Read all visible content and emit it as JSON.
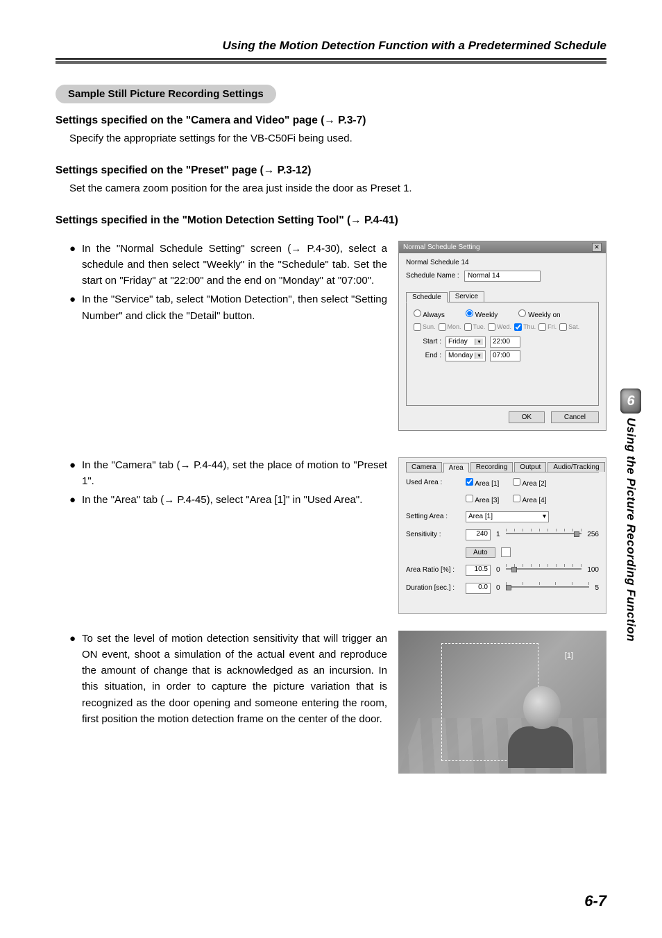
{
  "header": {
    "title": "Using the Motion Detection Function with a Predetermined Schedule"
  },
  "pill": "Sample Still Picture Recording Settings",
  "sec1": {
    "heading_a": "Settings specified on the \"Camera and Video\" page (",
    "heading_b": " P.3-7)",
    "body": "Specify the appropriate settings for the VB-C50Fi being used."
  },
  "sec2": {
    "heading_a": "Settings specified on the \"Preset\" page (",
    "heading_b": " P.3-12)",
    "body": "Set the camera zoom position for the area just inside the door as Preset 1."
  },
  "sec3": {
    "heading_a": "Settings specified in the \"Motion Detection Setting Tool\" (",
    "heading_b": " P.4-41)"
  },
  "block1": {
    "b1": "In the \"Normal Schedule Setting\" screen (→ P.4-30), select a schedule and then select \"Weekly\" in the \"Schedule\" tab. Set the start on \"Friday\" at \"22:00\" and the end on \"Monday\" at \"07:00\".",
    "b2": "In the \"Service\" tab, select \"Motion Detection\", then select \"Setting Number\" and click the \"Detail\" button."
  },
  "dialog1": {
    "title": "Normal Schedule Setting",
    "subtitle": "Normal Schedule 14",
    "name_label": "Schedule Name :",
    "name_value": "Normal 14",
    "tab_schedule": "Schedule",
    "tab_service": "Service",
    "radio_always": "Always",
    "radio_weekly": "Weekly",
    "radio_weekly_on": "Weekly on",
    "days": {
      "sun": "Sun.",
      "mon": "Mon.",
      "tue": "Tue.",
      "wed": "Wed.",
      "thu": "Thu.",
      "fri": "Fri.",
      "sat": "Sat."
    },
    "start_label": "Start :",
    "start_day": "Friday",
    "start_time": "22:00",
    "end_label": "End :",
    "end_day": "Monday",
    "end_time": "07:00",
    "ok": "OK",
    "cancel": "Cancel"
  },
  "block2": {
    "b1": "In the \"Camera\" tab (→ P.4-44), set the place of motion to \"Preset 1\".",
    "b2": "In the \"Area\" tab (→ P.4-45), select \"Area [1]\" in \"Used Area\"."
  },
  "panel2": {
    "tabs": {
      "camera": "Camera",
      "area": "Area",
      "recording": "Recording",
      "output": "Output",
      "audio": "Audio/Tracking"
    },
    "used_area_label": "Used Area :",
    "a1": "Area [1]",
    "a2": "Area [2]",
    "a3": "Area [3]",
    "a4": "Area [4]",
    "setting_area_label": "Setting Area :",
    "setting_area_value": "Area [1]",
    "sensitivity_label": "Sensitivity :",
    "sensitivity_value": "240",
    "sens_min": "1",
    "sens_max": "256",
    "auto_btn": "Auto",
    "area_ratio_label": "Area Ratio [%] :",
    "area_ratio_value": "10.5",
    "ratio_min": "0",
    "ratio_max": "100",
    "duration_label": "Duration [sec.] :",
    "duration_value": "0.0",
    "dur_min": "0",
    "dur_max": "5"
  },
  "block3": {
    "b1": "To set the level of motion detection sensitivity that will trigger an ON event, shoot a simulation of the actual event and reproduce the amount of change that is acknowledged as an incursion. In this situation, in order to capture the picture variation that is recognized as the door opening and someone entering the room, first position the motion detection frame on the center of the door."
  },
  "cam": {
    "label": "[1]"
  },
  "side": {
    "num": "6",
    "text": "Using the Picture Recording Function"
  },
  "page_number": "6-7"
}
